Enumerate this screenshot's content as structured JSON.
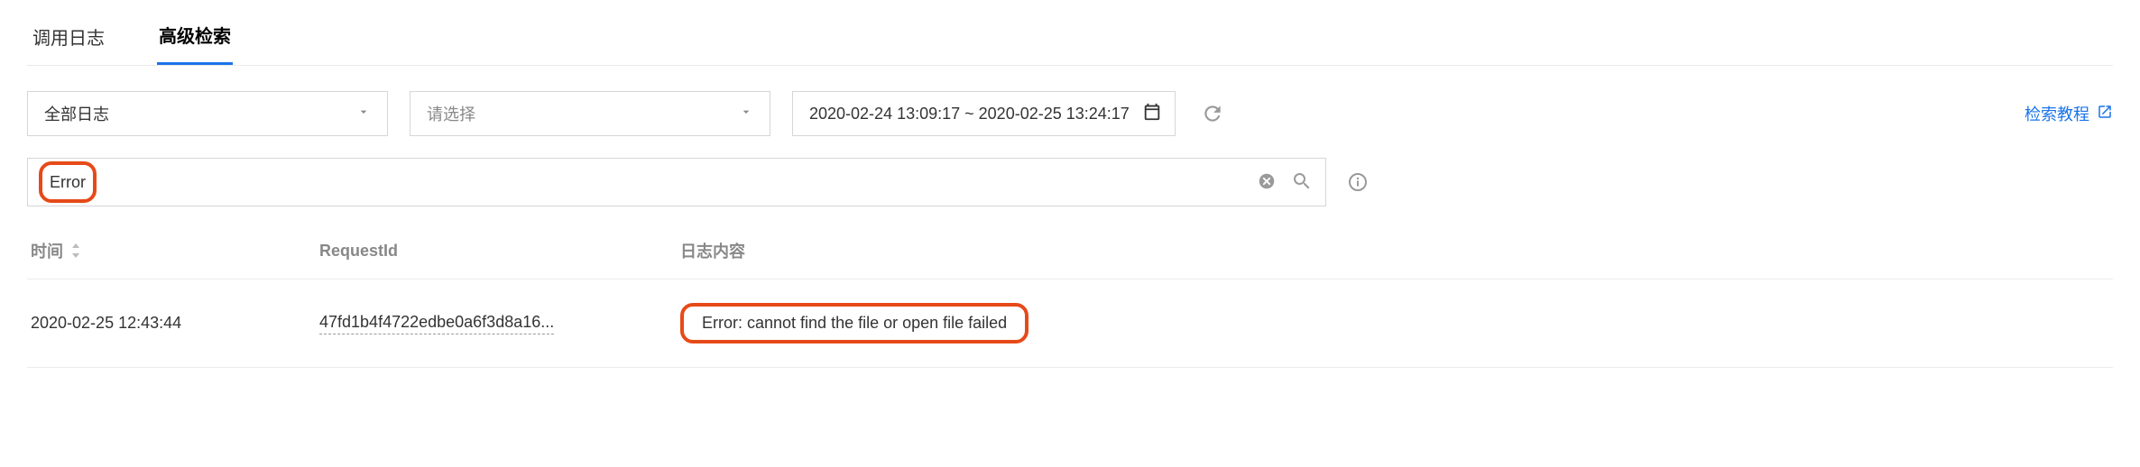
{
  "tabs": {
    "call_log": "调用日志",
    "advanced_search": "高级检索",
    "active": "advanced_search"
  },
  "filters": {
    "log_scope": "全部日志",
    "select_placeholder": "请选择",
    "date_range": "2020-02-24 13:09:17 ~ 2020-02-25 13:24:17"
  },
  "help": {
    "label": "检索教程"
  },
  "search": {
    "term": "Error"
  },
  "table": {
    "headers": {
      "time": "时间",
      "request_id": "RequestId",
      "content": "日志内容"
    },
    "rows": [
      {
        "time": "2020-02-25 12:43:44",
        "request_id": "47fd1b4f4722edbe0a6f3d8a16...",
        "content": "Error: cannot find the file or open file failed"
      }
    ]
  }
}
